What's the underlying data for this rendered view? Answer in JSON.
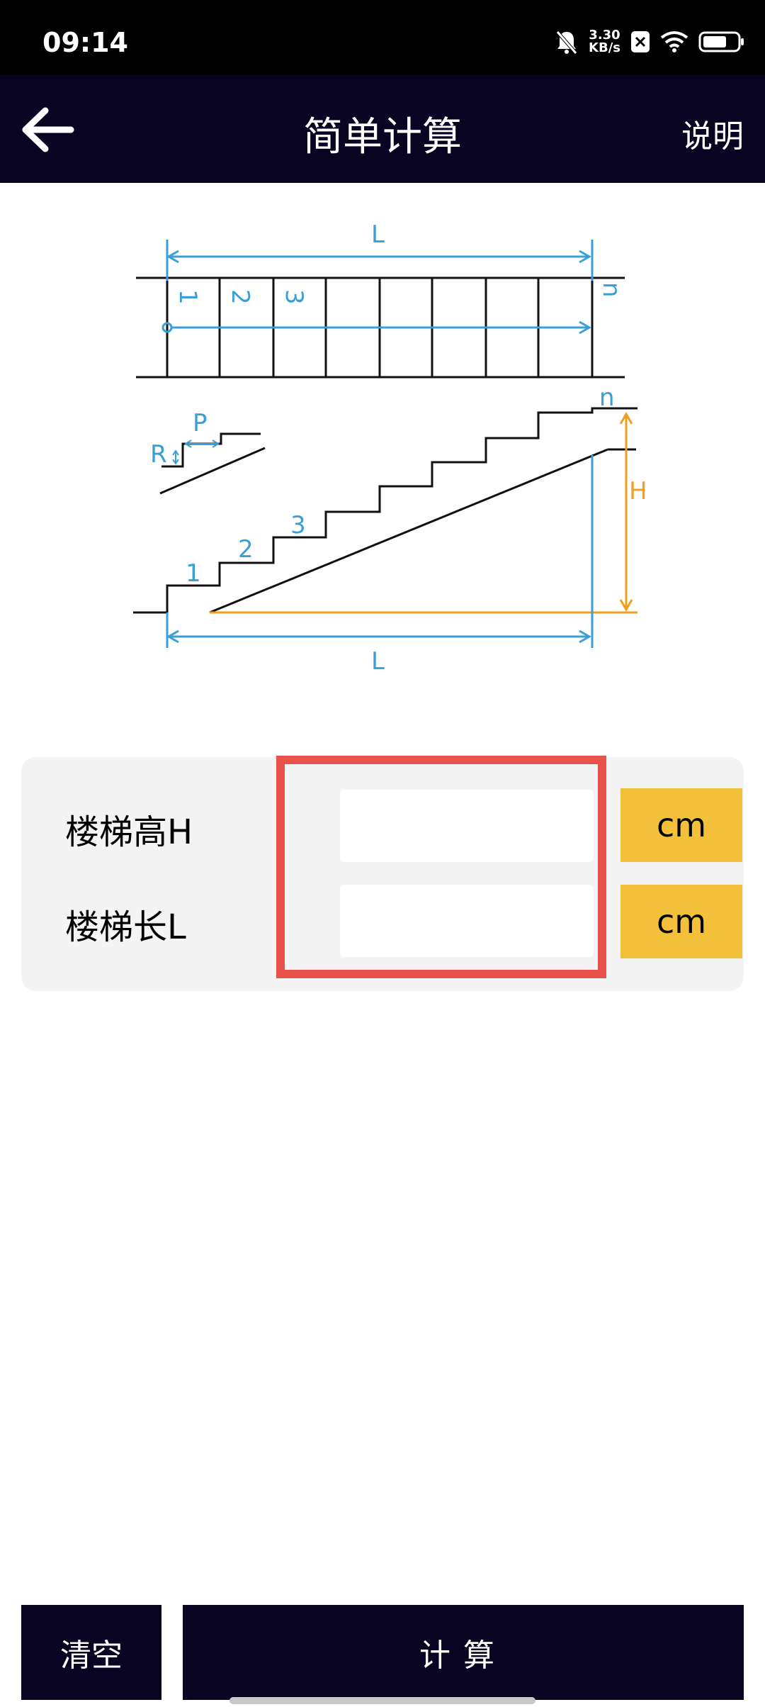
{
  "status_bar": {
    "time": "09:14",
    "net_speed_value": "3.30",
    "net_speed_unit": "KB/s",
    "icons": [
      "bell-muted-icon",
      "sim-x-icon",
      "wifi-icon",
      "battery-icon"
    ]
  },
  "header": {
    "title": "简单计算",
    "help_label": "说明",
    "back_icon": "arrow-left-icon"
  },
  "diagram": {
    "top_label_L": "L",
    "step_labels_top": [
      "1",
      "2",
      "3"
    ],
    "step_label_n_top": "n",
    "detail_label_R": "R",
    "detail_label_P": "P",
    "step_labels_side": [
      "1",
      "2",
      "3"
    ],
    "step_label_n_side": "n",
    "side_label_H": "H",
    "bottom_label_L": "L",
    "colors": {
      "blue": "#3a9fd6",
      "orange": "#f0a01e",
      "line": "#111111"
    }
  },
  "form": {
    "height_label": "楼梯高H",
    "height_value": "",
    "height_unit": "cm",
    "length_label": "楼梯长L",
    "length_value": "",
    "length_unit": "cm"
  },
  "actions": {
    "clear_label": "清空",
    "calc_label": "计算"
  },
  "colors": {
    "primary": "#080421",
    "accent": "#f2c039",
    "highlight": "#e8524a"
  }
}
